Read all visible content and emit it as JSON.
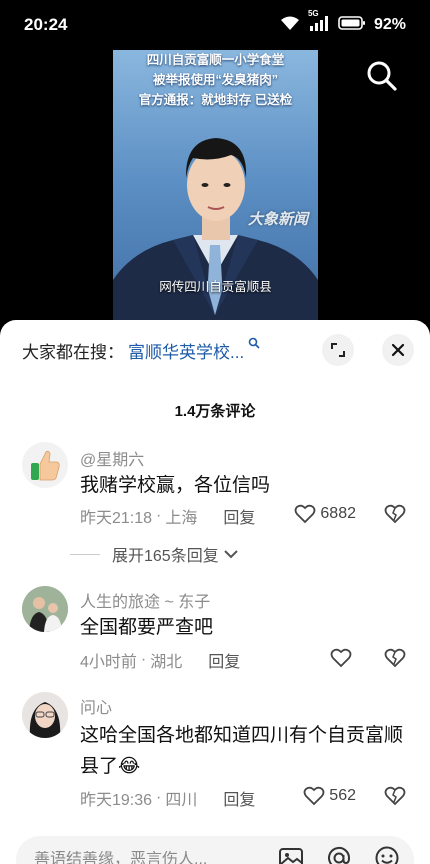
{
  "status_bar": {
    "time": "20:24",
    "network": "5G",
    "battery": "92%"
  },
  "video": {
    "caption_lines": [
      "四川自贡富顺一小学食堂",
      "被举报使用“发臭猪肉”",
      "官方通报：就地封存 已送检"
    ],
    "watermark": "大象新闻",
    "subtitle": "网传四川自贡富顺县"
  },
  "trending": {
    "prefix": "大家都在搜：",
    "query": "富顺华英学校..."
  },
  "comments_header": {
    "count_text": "1.4万条评论"
  },
  "comments": [
    {
      "user": "@星期六",
      "text": "我赌学校赢，各位信吗",
      "time": "昨天21:18",
      "location": "上海",
      "reply_label": "回复",
      "likes": "6882"
    },
    {
      "user": "人生的旅途 ~ 东子",
      "text": "全国都要严查吧",
      "time": "4小时前",
      "location": "湖北",
      "reply_label": "回复",
      "likes": ""
    },
    {
      "user": "问心",
      "text": "这哈全国各地都知道四川有个自贡富顺县了😂",
      "time": "昨天19:36",
      "location": "四川",
      "reply_label": "回复",
      "likes": "562"
    }
  ],
  "expand_replies": {
    "label": "展开165条回复"
  },
  "input": {
    "placeholder": "善语结善缘，恶言伤人..."
  },
  "icons": {
    "search": "search-icon",
    "expand": "expand-icon",
    "close": "close-icon",
    "like": "heart-icon",
    "dislike": "broken-heart-icon",
    "chevron": "chevron-down-icon",
    "image": "image-icon",
    "mention": "at-icon",
    "emoji": "emoji-icon"
  },
  "colors": {
    "link": "#1e5ba8",
    "meta": "#8c8c8c",
    "sheet_bg": "#ffffff"
  }
}
